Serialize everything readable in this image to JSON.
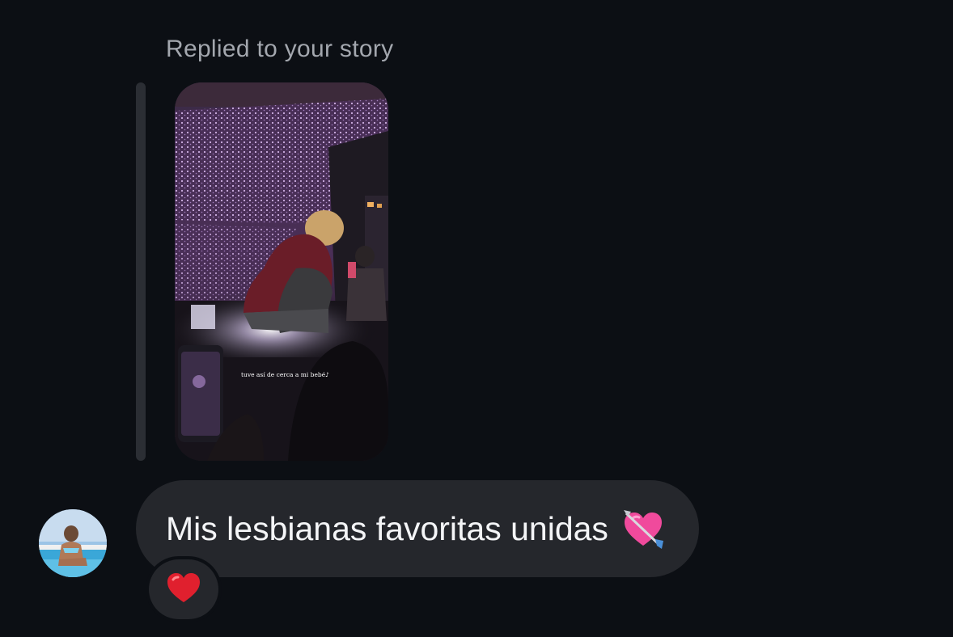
{
  "thread": {
    "reply_context": "Replied to your story",
    "story": {
      "caption": "tuve así de cerca a mi bebé♪"
    },
    "message": {
      "text": "Mis lesbianas favoritas unidas",
      "emoji": "heart-with-arrow-icon",
      "reaction": "red-heart-icon",
      "reaction_count": 1
    }
  },
  "colors": {
    "background": "#0c0f14",
    "bubble": "#25272c",
    "secondary_text": "#a3a7ae",
    "primary_text": "#f4f5f7",
    "reaction_heart": "#e0202e"
  }
}
